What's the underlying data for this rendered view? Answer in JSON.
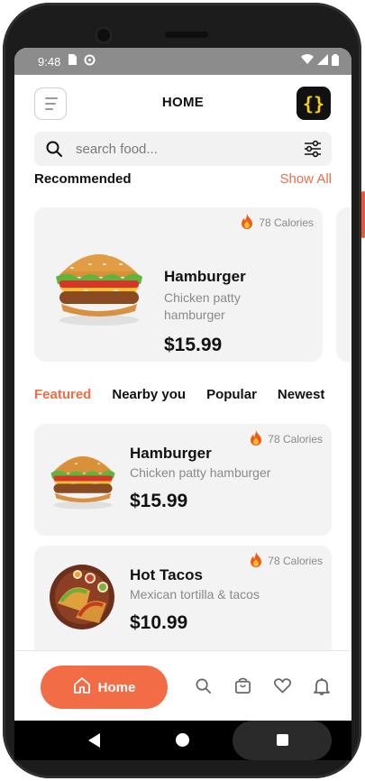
{
  "status_bar": {
    "time": "9:48"
  },
  "header": {
    "title": "HOME",
    "logo_text": "{}"
  },
  "search": {
    "placeholder": "search food..."
  },
  "recommended": {
    "title": "Recommended",
    "show_all": "Show All",
    "card": {
      "calories": "78 Calories",
      "name": "Hamburger",
      "desc_line1": "Chicken patty",
      "desc_line2": "hamburger",
      "price": "$15.99"
    }
  },
  "tabs": [
    "Featured",
    "Nearby you",
    "Popular",
    "Newest"
  ],
  "featured_items": [
    {
      "calories": "78 Calories",
      "name": "Hamburger",
      "desc": "Chicken patty hamburger",
      "price": "$15.99"
    },
    {
      "calories": "78 Calories",
      "name": "Hot Tacos",
      "desc": "Mexican tortilla & tacos",
      "price": "$10.99"
    }
  ],
  "bottom_nav": {
    "home_label": "Home"
  },
  "colors": {
    "accent": "#f26c46",
    "card_bg": "#f3f3f3",
    "logo_bg": "#111111",
    "logo_fg": "#f7d20a"
  }
}
